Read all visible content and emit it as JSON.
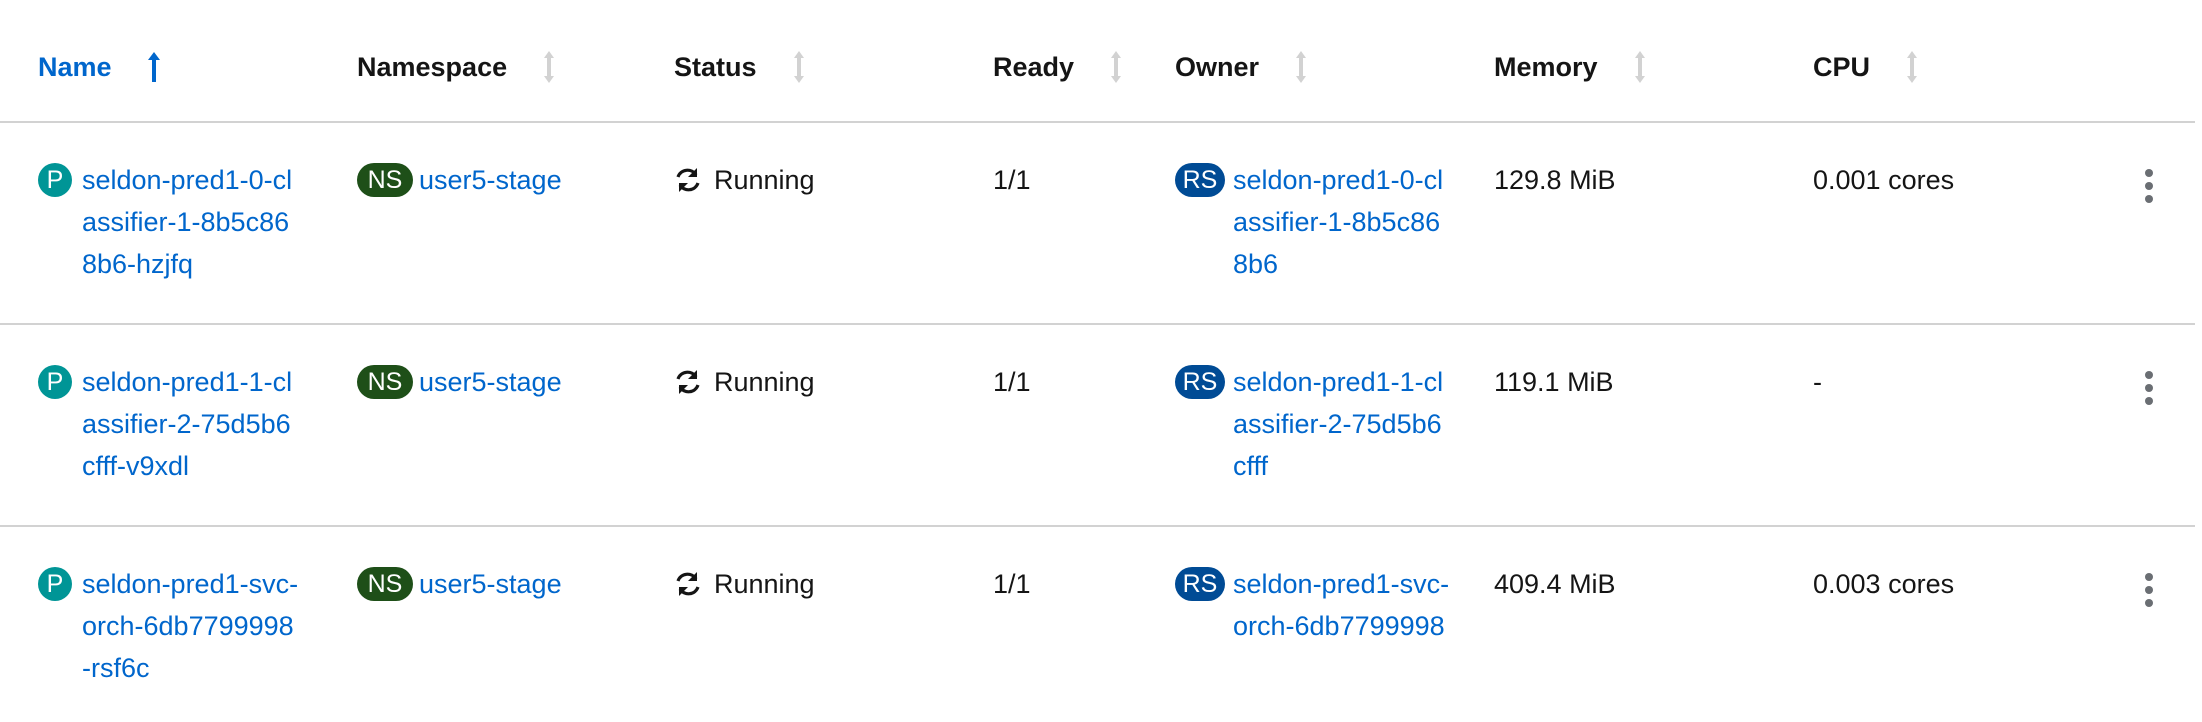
{
  "columns": {
    "name": "Name",
    "namespace": "Namespace",
    "status": "Status",
    "ready": "Ready",
    "owner": "Owner",
    "memory": "Memory",
    "cpu": "CPU"
  },
  "sort": {
    "column": "Name",
    "direction": "ascending"
  },
  "colors": {
    "link": "#0066cc",
    "pod_badge": "#009596",
    "ns_badge": "#1e4f18",
    "rs_badge": "#004b95"
  },
  "rows": [
    {
      "kind_badge": "P",
      "name": "seldon-pred1-0-classifier-1-8b5c868b6-hzjfq",
      "ns_badge": "NS",
      "namespace": "user5-stage",
      "status": "Running",
      "ready": "1/1",
      "owner_badge": "RS",
      "owner": "seldon-pred1-0-classifier-1-8b5c868b6",
      "memory": "129.8 MiB",
      "cpu": "0.001 cores"
    },
    {
      "kind_badge": "P",
      "name": "seldon-pred1-1-classifier-2-75d5b6cfff-v9xdl",
      "ns_badge": "NS",
      "namespace": "user5-stage",
      "status": "Running",
      "ready": "1/1",
      "owner_badge": "RS",
      "owner": "seldon-pred1-1-classifier-2-75d5b6cfff",
      "memory": "119.1 MiB",
      "cpu": "-"
    },
    {
      "kind_badge": "P",
      "name": "seldon-pred1-svc-orch-6db7799998-rsf6c",
      "ns_badge": "NS",
      "namespace": "user5-stage",
      "status": "Running",
      "ready": "1/1",
      "owner_badge": "RS",
      "owner": "seldon-pred1-svc-orch-6db7799998",
      "memory": "409.4 MiB",
      "cpu": "0.003 cores"
    }
  ]
}
